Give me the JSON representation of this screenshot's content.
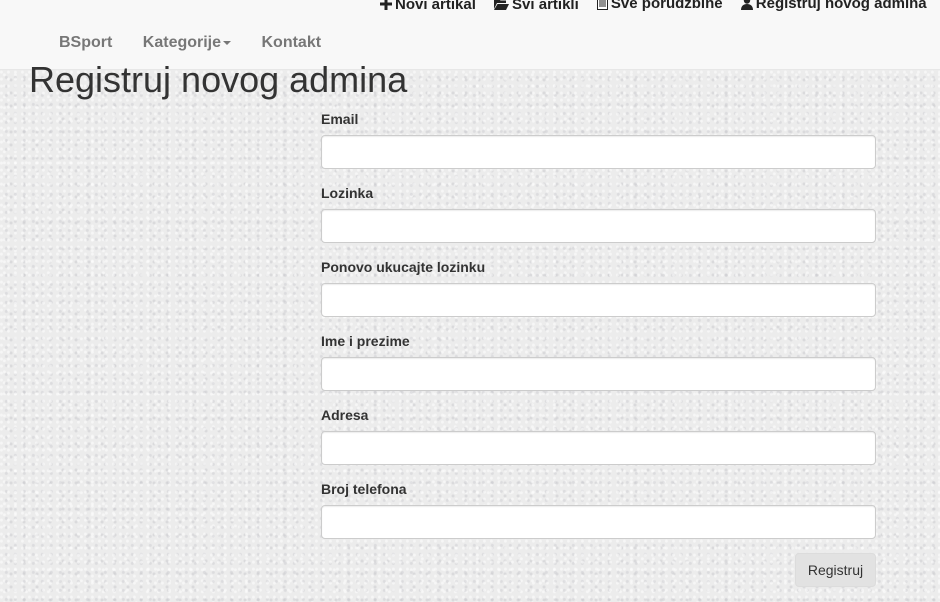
{
  "header": {
    "top_links": [
      {
        "icon": "plus-icon",
        "label": "Novi artikal"
      },
      {
        "icon": "folder-open-icon",
        "label": "Svi artikli"
      },
      {
        "icon": "list-document-icon",
        "label": "Sve porudzbine"
      },
      {
        "icon": "user-icon",
        "label": "Registruj novog admina"
      }
    ],
    "nav": {
      "brand": "BSport",
      "categories": "Kategorije",
      "contact": "Kontakt"
    }
  },
  "page": {
    "title": "Registruj novog admina"
  },
  "form": {
    "fields": [
      {
        "label": "Email",
        "value": "",
        "placeholder": ""
      },
      {
        "label": "Lozinka",
        "value": "",
        "placeholder": ""
      },
      {
        "label": "Ponovo ukucajte lozinku",
        "value": "",
        "placeholder": ""
      },
      {
        "label": "Ime i prezime",
        "value": "",
        "placeholder": ""
      },
      {
        "label": "Adresa",
        "value": "",
        "placeholder": ""
      },
      {
        "label": "Broj telefona",
        "value": "",
        "placeholder": ""
      }
    ],
    "submit_label": "Registruj"
  }
}
